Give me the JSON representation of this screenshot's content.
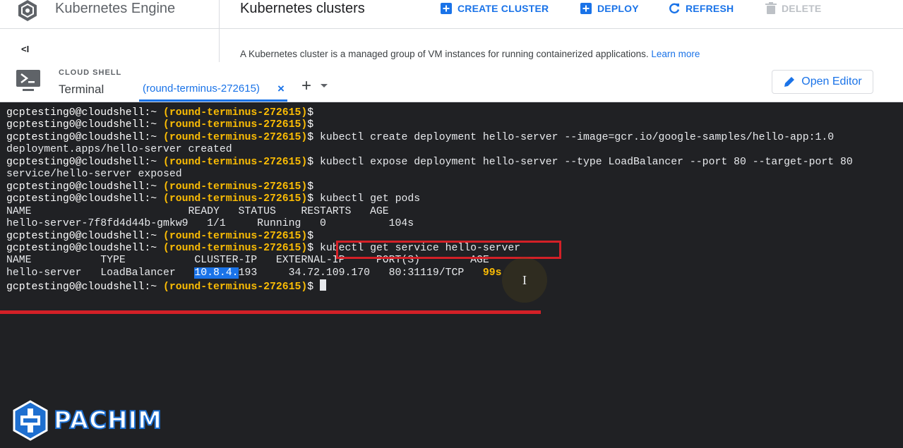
{
  "header": {
    "product": "Kubernetes Engine",
    "page_title": "Kubernetes clusters",
    "toolbar": {
      "create_label": "CREATE CLUSTER",
      "deploy_label": "DEPLOY",
      "refresh_label": "REFRESH",
      "delete_label": "DELETE"
    },
    "collapse_label": "<I",
    "description": "A Kubernetes cluster is a managed group of VM instances for running containerized applications.",
    "learn_more": "Learn more"
  },
  "shell": {
    "label": "CLOUD SHELL",
    "title": "Terminal",
    "tab_label": "(round-terminus-272615)",
    "tab_close": "×",
    "add_tab": "+",
    "open_editor": "Open Editor"
  },
  "terminal": {
    "prompt": "gcptesting0@cloudshell:~",
    "project": "(round-terminus-272615)",
    "symbol": "$",
    "commands": {
      "create": "kubectl create deployment hello-server --image=gcr.io/google-samples/hello-app:1.0",
      "expose": "kubectl expose deployment hello-server --type LoadBalancer --port 80 --target-port 80",
      "get_pods": "kubectl get pods",
      "get_service": "kubectl get service hello-server"
    },
    "outputs": {
      "created": "deployment.apps/hello-server created",
      "exposed": "service/hello-server exposed"
    },
    "pods_table": {
      "header": "NAME                         READY   STATUS    RESTARTS   AGE",
      "row": "hello-server-7f8fd4d44b-gmkw9   1/1     Running   0          104s"
    },
    "service_table": {
      "header": "NAME           TYPE           CLUSTER-IP   EXTERNAL-IP     PORT(S)        AGE",
      "row_name": "hello-server   LoadBalancer   ",
      "cluster_ip_highlight": "10.8.4.",
      "cluster_ip_rest": "193",
      "row_mid": "     34.72.109.170   80:31119/TCP   ",
      "age": "99s"
    }
  },
  "watermark": {
    "text": "PACHIM"
  },
  "colors": {
    "accent": "#1a73e8",
    "terminal_bg": "#202124",
    "project": "#fbbc04",
    "annotation": "#d32027"
  },
  "icons": {
    "logo": "kubernetes-engine-logo-icon",
    "create": "add-box-icon",
    "deploy": "add-box-icon",
    "refresh": "refresh-icon",
    "delete": "trash-icon",
    "shell": "terminal-icon",
    "editor": "pencil-icon"
  }
}
